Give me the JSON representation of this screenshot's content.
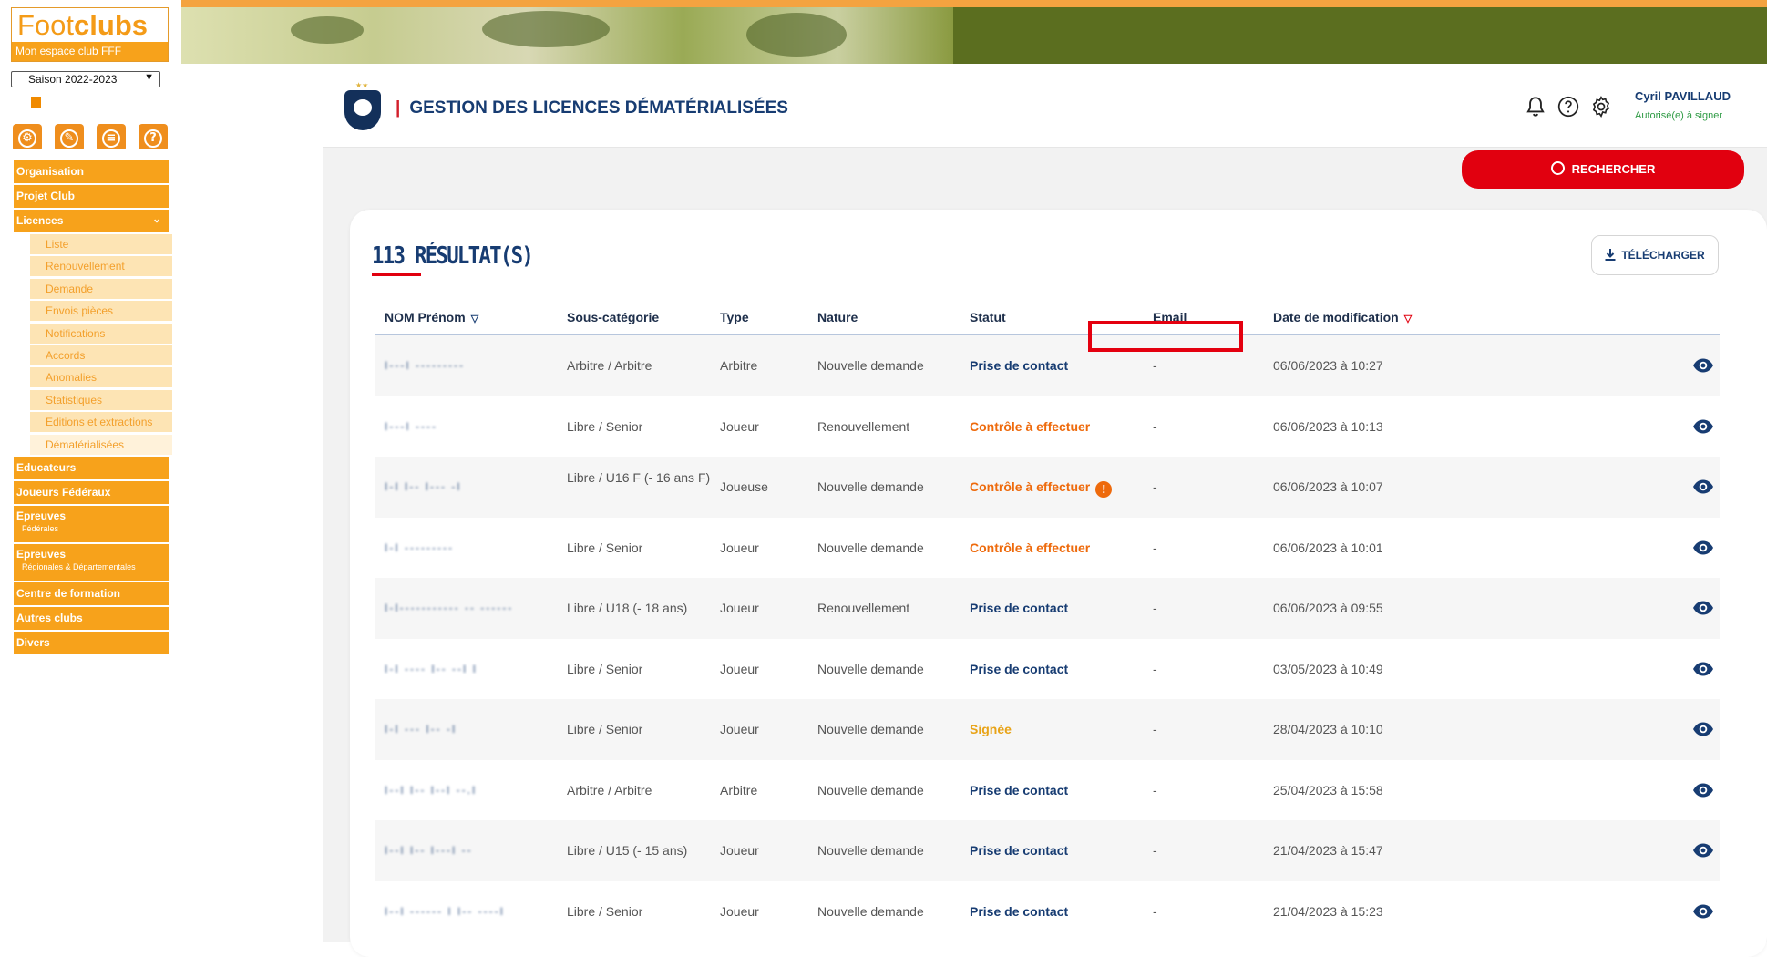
{
  "sidebar": {
    "logo_word_a": "Foot",
    "logo_word_b": "clubs",
    "logo_tagline": "Mon espace club FFF",
    "season": "Saison 2022-2023",
    "menu": [
      {
        "label": "Organisation"
      },
      {
        "label": "Projet Club"
      },
      {
        "label": "Licences",
        "expanded": true
      },
      {
        "label": "Educateurs"
      },
      {
        "label": "Joueurs Fédéraux"
      },
      {
        "label": "Epreuves",
        "sub": "Fédérales"
      },
      {
        "label": "Epreuves",
        "sub": "Régionales & Départementales"
      },
      {
        "label": "Centre de formation"
      },
      {
        "label": "Autres clubs"
      },
      {
        "label": "Divers"
      }
    ],
    "licences_sub": [
      "Liste",
      "Renouvellement",
      "Demande",
      "Envois pièces",
      "Notifications",
      "Accords",
      "Anomalies",
      "Statistiques",
      "Editions et extractions",
      "Dématérialisées"
    ]
  },
  "header": {
    "title": "GESTION DES LICENCES DÉMATÉRIALISÉES",
    "user_name": "Cyril PAVILLAUD",
    "user_role": "Autorisé(e) à signer"
  },
  "toolbar": {
    "search_label": "RECHERCHER",
    "download_label": "TÉLÉCHARGER"
  },
  "results": {
    "count_label": "113 RÉSULTAT(S)"
  },
  "table": {
    "columns": [
      "NOM Prénom",
      "Sous-catégorie",
      "Type",
      "Nature",
      "Statut",
      "Email",
      "Date de modification"
    ],
    "rows": [
      {
        "name": "I---I ---------",
        "sous_categorie": "Arbitre / Arbitre",
        "type": "Arbitre",
        "nature": "Nouvelle demande",
        "statut": "Prise de contact",
        "status_kind": "blue",
        "email": "-",
        "date": "06/06/2023 à 10:27"
      },
      {
        "name": "I---I ----",
        "sous_categorie": "Libre / Senior",
        "type": "Joueur",
        "nature": "Renouvellement",
        "statut": "Contrôle à effectuer",
        "status_kind": "orange",
        "email": "-",
        "date": "06/06/2023 à 10:13"
      },
      {
        "name": "I-I I-- I--- -I",
        "sous_categorie": "Libre / U16 F (- 16 ans F)",
        "type": "Joueuse",
        "nature": "Nouvelle demande",
        "statut": "Contrôle à effectuer",
        "status_kind": "orange",
        "warning": true,
        "email": "-",
        "date": "06/06/2023 à 10:07"
      },
      {
        "name": "I-I ---------",
        "sous_categorie": "Libre / Senior",
        "type": "Joueur",
        "nature": "Nouvelle demande",
        "statut": "Contrôle à effectuer",
        "status_kind": "orange",
        "email": "-",
        "date": "06/06/2023 à 10:01"
      },
      {
        "name": "I-I----------- -- ------",
        "sous_categorie": "Libre / U18 (- 18 ans)",
        "type": "Joueur",
        "nature": "Renouvellement",
        "statut": "Prise de contact",
        "status_kind": "blue",
        "email": "-",
        "date": "06/06/2023 à 09:55"
      },
      {
        "name": "I-I ---- I-- --I I",
        "sous_categorie": "Libre / Senior",
        "type": "Joueur",
        "nature": "Nouvelle demande",
        "statut": "Prise de contact",
        "status_kind": "blue",
        "email": "-",
        "date": "03/05/2023 à 10:49"
      },
      {
        "name": "I-I --- I-- -I",
        "sous_categorie": "Libre / Senior",
        "type": "Joueur",
        "nature": "Nouvelle demande",
        "statut": "Signée",
        "status_kind": "yellow",
        "email": "-",
        "date": "28/04/2023 à 10:10"
      },
      {
        "name": "I--I I-- I--I --.I",
        "sous_categorie": "Arbitre / Arbitre",
        "type": "Arbitre",
        "nature": "Nouvelle demande",
        "statut": "Prise de contact",
        "status_kind": "blue",
        "email": "-",
        "date": "25/04/2023 à 15:58"
      },
      {
        "name": "I--I I-- I---I --",
        "sous_categorie": "Libre / U15 (- 15 ans)",
        "type": "Joueur",
        "nature": "Nouvelle demande",
        "statut": "Prise de contact",
        "status_kind": "blue",
        "email": "-",
        "date": "21/04/2023 à 15:47"
      },
      {
        "name": "I--I ------ I I-- ----I",
        "sous_categorie": "Libre / Senior",
        "type": "Joueur",
        "nature": "Nouvelle demande",
        "statut": "Prise de contact",
        "status_kind": "blue",
        "email": "-",
        "date": "21/04/2023 à 15:23"
      }
    ]
  },
  "colors": {
    "brand_orange": "#f7a21b",
    "fff_blue": "#173c72",
    "fff_red": "#e1000f",
    "status_blue": "#173c72",
    "status_orange": "#ee6a0c",
    "status_yellow": "#e8a317"
  },
  "icons": [
    "bell-icon",
    "help-icon",
    "gear-icon",
    "search-icon",
    "download-icon",
    "eye-icon",
    "warning-icon",
    "chevron-down-icon"
  ]
}
